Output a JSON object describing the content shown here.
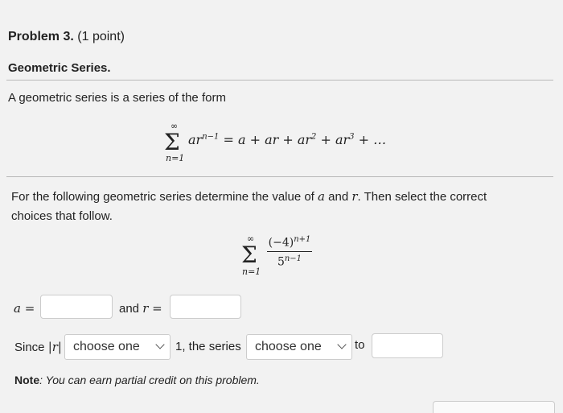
{
  "problem": {
    "title_bold": "Problem 3.",
    "title_points": "(1 point)",
    "subtitle": "Geometric Series.",
    "intro": "A geometric series is a series of the form"
  },
  "formula1": {
    "sum_top": "∞",
    "sum_bottom": "n=1",
    "term_base": "ar",
    "term_exp": "n−1",
    "eq_parts": [
      "= a + ar + ar",
      "2",
      " + ar",
      "3",
      " + …"
    ]
  },
  "question": {
    "prefix": "For the following geometric series determine the value of ",
    "var_a": "a",
    "mid": " and ",
    "var_r": "r",
    "suffix": ". Then select the correct choices that follow."
  },
  "formula2": {
    "sum_top": "∞",
    "sum_bottom": "n=1",
    "numerator_base": "(−4)",
    "numerator_exp": "n+1",
    "denominator_base": "5",
    "denominator_exp": "n−1"
  },
  "answers": {
    "a_label": "a =",
    "and_label": "and",
    "r_label": "r =",
    "a_value": "",
    "r_value": ""
  },
  "since": {
    "prefix": "Since ",
    "abs_r": "|r|",
    "select1": "choose one",
    "mid": "1, the series",
    "select2": "choose one",
    "to": "to",
    "to_value": ""
  },
  "note": {
    "label": "Note",
    "text": ": You can earn partial credit on this problem."
  }
}
